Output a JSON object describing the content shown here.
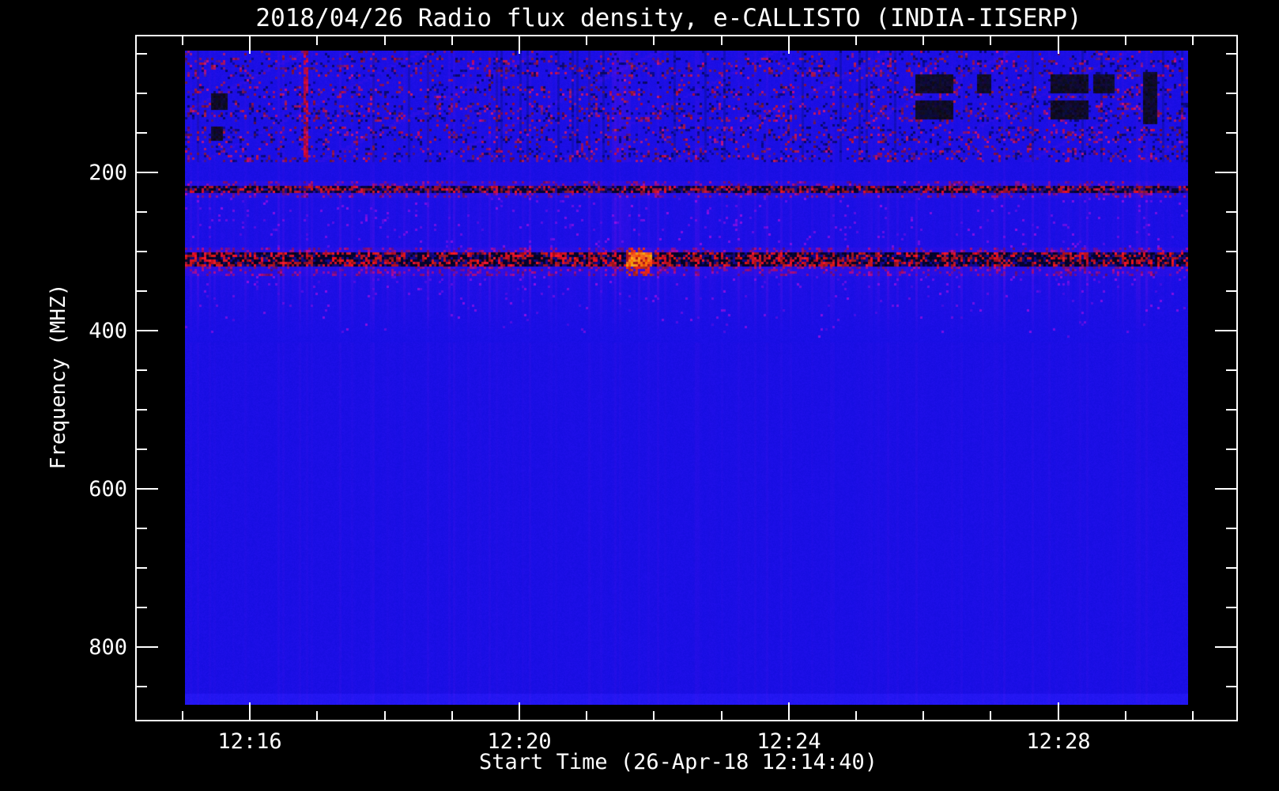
{
  "title": "2018/04/26  Radio flux density, e-CALLISTO (INDIA-IISERP)",
  "colors": {
    "background": "#000000",
    "axis": "#ffffff",
    "base_blue": "#1a0fe5",
    "rfi_red": "#cc1400",
    "burst_orange": "#ff6a00",
    "band_dark": "#000428"
  },
  "chart_data": {
    "type": "heatmap",
    "subtype": "radio-spectrogram",
    "title": "2018/04/26  Radio flux density, e-CALLISTO (INDIA-IISERP)",
    "date": "2018/04/26",
    "station": "INDIA-IISERP",
    "instrument": "e-CALLISTO",
    "xlabel": "Start Time (26-Apr-18 12:14:40)",
    "ylabel": "Frequency (MHZ)",
    "x_axis": {
      "major_ticks": [
        {
          "label": "12:16",
          "min": 1
        },
        {
          "label": "12:20",
          "min": 5
        },
        {
          "label": "12:24",
          "min": 9
        },
        {
          "label": "12:28",
          "min": 13
        }
      ],
      "minor_every_min": 1,
      "minor_range_min": [
        0,
        15
      ],
      "epoch_of_min0": "12:15"
    },
    "y_axis": {
      "major_ticks": [
        {
          "label": "200",
          "mhz": 200
        },
        {
          "label": "400",
          "mhz": 400
        },
        {
          "label": "600",
          "mhz": 600
        },
        {
          "label": "800",
          "mhz": 800
        }
      ],
      "minor_every_mhz": 50,
      "minor_range_mhz": [
        50,
        850
      ],
      "inverted": true
    },
    "freq_range_mhz": [
      46,
      873
    ],
    "time_range": [
      "12:15:00",
      "12:29:56"
    ],
    "features": {
      "noise_region_mhz": [
        46,
        186
      ],
      "noise_row_bands_mhz": [
        [
          54,
          78
        ],
        [
          90,
          104
        ],
        [
          112,
          134
        ],
        [
          142,
          162
        ],
        [
          170,
          186
        ]
      ],
      "rfi_band_1": {
        "glow_mhz": [
          211,
          230
        ],
        "core_mhz": [
          217,
          225
        ],
        "hot_segments": [
          {
            "t": [
              6.4,
              7.1
            ],
            "k": 1.6
          },
          {
            "t": [
              10.8,
              12.0
            ],
            "k": 1.4
          }
        ]
      },
      "rfi_band_2": {
        "glow_mhz": [
          294,
          330
        ],
        "core_mhz": [
          302,
          317
        ],
        "hot_segments": [
          {
            "t": [
              0.0,
              0.78
            ],
            "k": 1.5
          },
          {
            "t": [
              2.6,
              3.36
            ],
            "k": 1.55
          },
          {
            "t": [
              4.3,
              5.0
            ],
            "k": 1.5
          },
          {
            "t": [
              7.06,
              7.32
            ],
            "k": 1.9
          },
          {
            "t": [
              8.4,
              9.0
            ],
            "k": 1.6
          },
          {
            "t": [
              9.7,
              9.95
            ],
            "k": 1.5
          },
          {
            "t": [
              12.86,
              13.17
            ],
            "k": 1.45
          },
          {
            "t": [
              13.98,
              14.4
            ],
            "k": 1.5
          }
        ],
        "peak": {
          "t": [
            6.59,
            6.97
          ],
          "f": [
            302,
            316
          ],
          "time_label": "~12:21:40"
        }
      },
      "flare_column_t": [
        6.35,
        6.65
      ],
      "red_line_t": 1.83,
      "thin_red_line": {
        "t": 10.7,
        "f": [
          294,
          360
        ]
      },
      "dark_patches": [
        {
          "t": [
            10.87,
            11.45
          ],
          "f": [
            77,
            99
          ]
        },
        {
          "t": [
            10.87,
            11.45
          ],
          "f": [
            110,
            132
          ]
        },
        {
          "t": [
            11.78,
            12.0
          ],
          "f": [
            77,
            99
          ]
        },
        {
          "t": [
            12.89,
            13.43
          ],
          "f": [
            77,
            99
          ]
        },
        {
          "t": [
            12.89,
            13.43
          ],
          "f": [
            110,
            132
          ]
        },
        {
          "t": [
            13.51,
            13.83
          ],
          "f": [
            77,
            99
          ]
        },
        {
          "t": [
            14.25,
            14.48
          ],
          "f": [
            72,
            137
          ]
        },
        {
          "t": [
            0.4,
            0.66
          ],
          "f": [
            100,
            120
          ]
        },
        {
          "t": [
            0.42,
            0.59
          ],
          "f": [
            142,
            158
          ]
        }
      ],
      "fade_region_mhz": [
        331,
        414
      ],
      "quiet_region_mhz": [
        415,
        873
      ]
    }
  }
}
